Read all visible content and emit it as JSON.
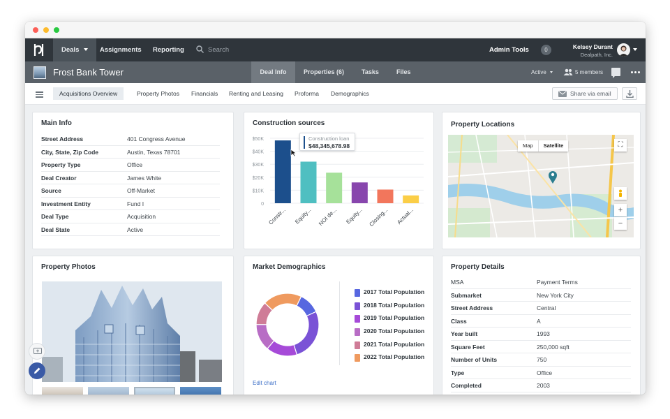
{
  "nav": {
    "deals": "Deals",
    "assignments": "Assignments",
    "reporting": "Reporting",
    "search_placeholder": "Search",
    "admin_tools": "Admin Tools",
    "notifications": "0",
    "user_name": "Kelsey Durant",
    "user_company": "Dealpath, Inc."
  },
  "property": {
    "title": "Frost Bank Tower",
    "tabs": [
      "Deal Info",
      "Properties (6)",
      "Tasks",
      "Files"
    ],
    "status": "Active",
    "members": "5 members"
  },
  "subnav": {
    "tabs": [
      "Acquisitions Overview",
      "Property Photos",
      "Financials",
      "Renting and Leasing",
      "Proforma",
      "Demographics"
    ],
    "share": "Share via email"
  },
  "main_info": {
    "title": "Main Info",
    "rows": [
      {
        "k": "Street Address",
        "v": "401 Congress Avenue"
      },
      {
        "k": "City, State, Zip Code",
        "v": "Austin, Texas 78701"
      },
      {
        "k": "Property Type",
        "v": "Office"
      },
      {
        "k": "Deal Creator",
        "v": "James White"
      },
      {
        "k": "Source",
        "v": "Off-Market"
      },
      {
        "k": "Investment Entity",
        "v": "Fund I"
      },
      {
        "k": "Deal Type",
        "v": "Acquisition"
      },
      {
        "k": "Deal State",
        "v": "Active"
      }
    ]
  },
  "construction": {
    "title": "Construction sources",
    "tooltip_label": "Construction loan",
    "tooltip_value": "$48,345,678.98"
  },
  "chart_data": [
    {
      "type": "bar",
      "title": "Construction sources",
      "categories": [
        "Constr...",
        "Equity...",
        "NOI de...",
        "Equity...",
        "Closing...",
        "Actual..."
      ],
      "values": [
        48345678.98,
        32000000,
        23500000,
        16000000,
        10500000,
        6000000
      ],
      "colors": [
        "#1c4f8c",
        "#4fbfc1",
        "#a6e19a",
        "#8846ad",
        "#f2765c",
        "#fbce47"
      ],
      "yticks": [
        "$50K",
        "$40K",
        "$30K",
        "$20K",
        "$10K",
        "0"
      ],
      "ylim": [
        0,
        50000000
      ]
    },
    {
      "type": "pie",
      "title": "Market Demographics",
      "categories": [
        "2017 Total Population",
        "2018 Total Population",
        "2019 Total Population",
        "2020 Total Population",
        "2021 Total Population",
        "2022 Total Population"
      ],
      "values": [
        11,
        27,
        16,
        14,
        12,
        20
      ],
      "colors": [
        "#5767e0",
        "#7a52d6",
        "#a64ad8",
        "#b86dc5",
        "#cf7c97",
        "#ef9a5f"
      ],
      "order_cw_from_top": [
        0,
        1,
        2,
        3,
        4,
        5
      ]
    }
  ],
  "locations": {
    "title": "Property Locations",
    "map_btn": "Map",
    "satellite_btn": "Satellite"
  },
  "photos": {
    "title": "Property Photos"
  },
  "demographics": {
    "title": "Market Demographics",
    "edit": "Edit chart"
  },
  "details": {
    "title": "Property Details",
    "rows": [
      {
        "k": "MSA",
        "v": "Payment Terms"
      },
      {
        "k": "Submarket",
        "v": "New York City"
      },
      {
        "k": "Street Address",
        "v": "Central"
      },
      {
        "k": "Class",
        "v": "A"
      },
      {
        "k": "Year built",
        "v": "1993"
      },
      {
        "k": "Square Feet",
        "v": "250,000 sqft"
      },
      {
        "k": "Number of Units",
        "v": "750"
      },
      {
        "k": "Type",
        "v": "Office"
      },
      {
        "k": "Completed",
        "v": "2003"
      }
    ]
  }
}
